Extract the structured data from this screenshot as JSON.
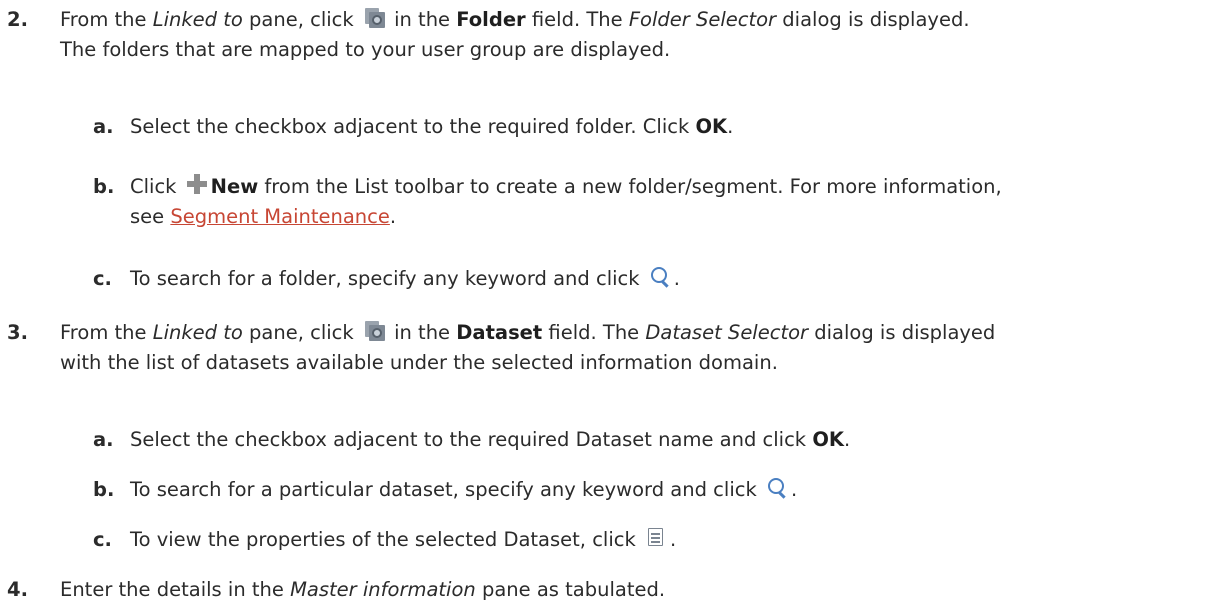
{
  "steps": [
    {
      "number": "2.",
      "pre1": "From the ",
      "pane": "Linked to",
      "pre2": " pane, click ",
      "icon": "folder-settings-icon",
      "mid": " in the ",
      "field": "Folder",
      "post1": " field. The ",
      "dialog": "Folder Selector",
      "post2": " dialog is displayed.",
      "line2": "The folders that are mapped to your user group are displayed.",
      "substeps": [
        {
          "letter": "a.",
          "text1": "Select the checkbox adjacent to the required folder. Click ",
          "bold": "OK",
          "text2": "."
        },
        {
          "letter": "b.",
          "text1": "Click ",
          "icon": "plus-icon",
          "bold": "New",
          "text2": " from the List toolbar to create a new folder/segment. For more information,",
          "line2_pre": "see ",
          "link": "Segment Maintenance",
          "line2_post": "."
        },
        {
          "letter": "c.",
          "text1": "To search for a folder, specify any keyword and click ",
          "icon": "search-icon",
          "text2": "."
        }
      ]
    },
    {
      "number": "3.",
      "pre1": "From the ",
      "pane": "Linked to",
      "pre2": " pane, click ",
      "icon": "folder-settings-icon",
      "mid": " in the ",
      "field": "Dataset",
      "post1": " field. The ",
      "dialog": "Dataset Selector",
      "post2": " dialog is displayed",
      "line2": "with the list of datasets available under the selected information domain.",
      "substeps": [
        {
          "letter": "a.",
          "text1": "Select the checkbox adjacent to the required Dataset name and click ",
          "bold": "OK",
          "text2": "."
        },
        {
          "letter": "b.",
          "text1": "To search for a particular dataset, specify any keyword and click ",
          "icon": "search-icon",
          "text2": "."
        },
        {
          "letter": "c.",
          "text1": "To view the properties of the selected Dataset, click ",
          "icon": "properties-icon",
          "text2": "."
        }
      ]
    },
    {
      "number": "4.",
      "pre1": "Enter the details in the ",
      "pane": "Master information",
      "post2": " pane as tabulated."
    }
  ]
}
